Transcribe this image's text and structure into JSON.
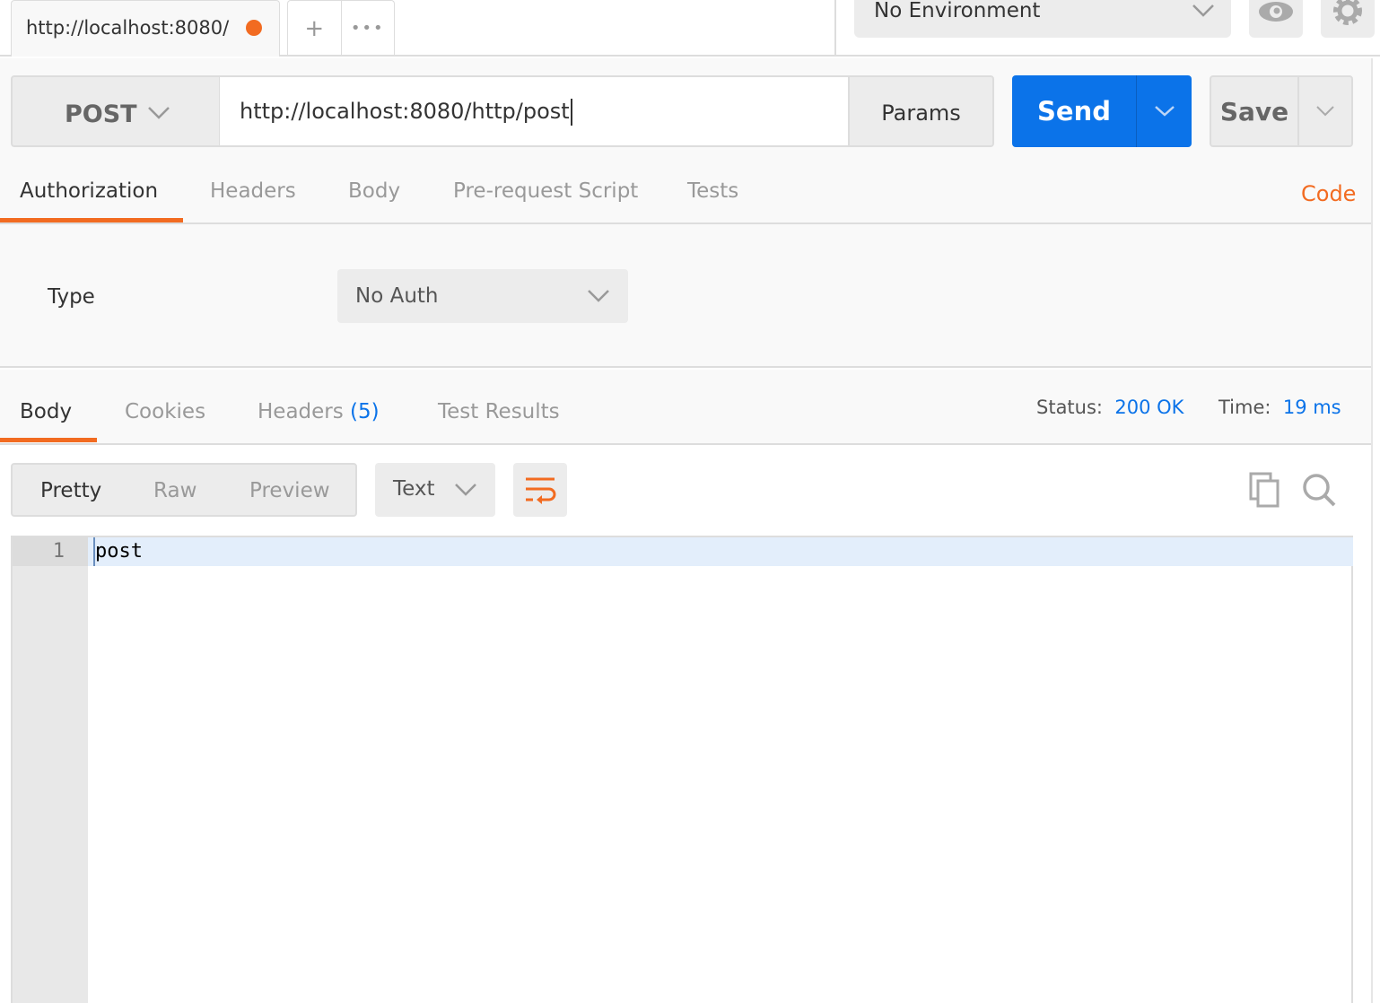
{
  "tabs": {
    "active_tab": "http://localhost:8080/",
    "unsaved_color": "#f26b21",
    "new_tab": "+",
    "more": "•••"
  },
  "environment": {
    "selected": "No Environment"
  },
  "request": {
    "method": "POST",
    "url": "http://localhost:8080/http/post",
    "params_label": "Params",
    "send_label": "Send",
    "save_label": "Save",
    "tabs": [
      "Authorization",
      "Headers",
      "Body",
      "Pre-request Script",
      "Tests"
    ],
    "active_tab": "Authorization",
    "code_label": "Code"
  },
  "auth": {
    "type_label": "Type",
    "type_value": "No Auth"
  },
  "response": {
    "tabs": [
      "Body",
      "Cookies",
      "Headers",
      "Test Results"
    ],
    "headers_count": "(5)",
    "active_tab": "Body",
    "status_label": "Status:",
    "status_value": "200 OK",
    "time_label": "Time:",
    "time_value": "19 ms",
    "view_modes": [
      "Pretty",
      "Raw",
      "Preview"
    ],
    "active_view": "Pretty",
    "format": "Text",
    "lines": [
      {
        "num": "1",
        "text": "post"
      }
    ]
  },
  "colors": {
    "accent": "#f26b21",
    "primary": "#0b73e9"
  }
}
